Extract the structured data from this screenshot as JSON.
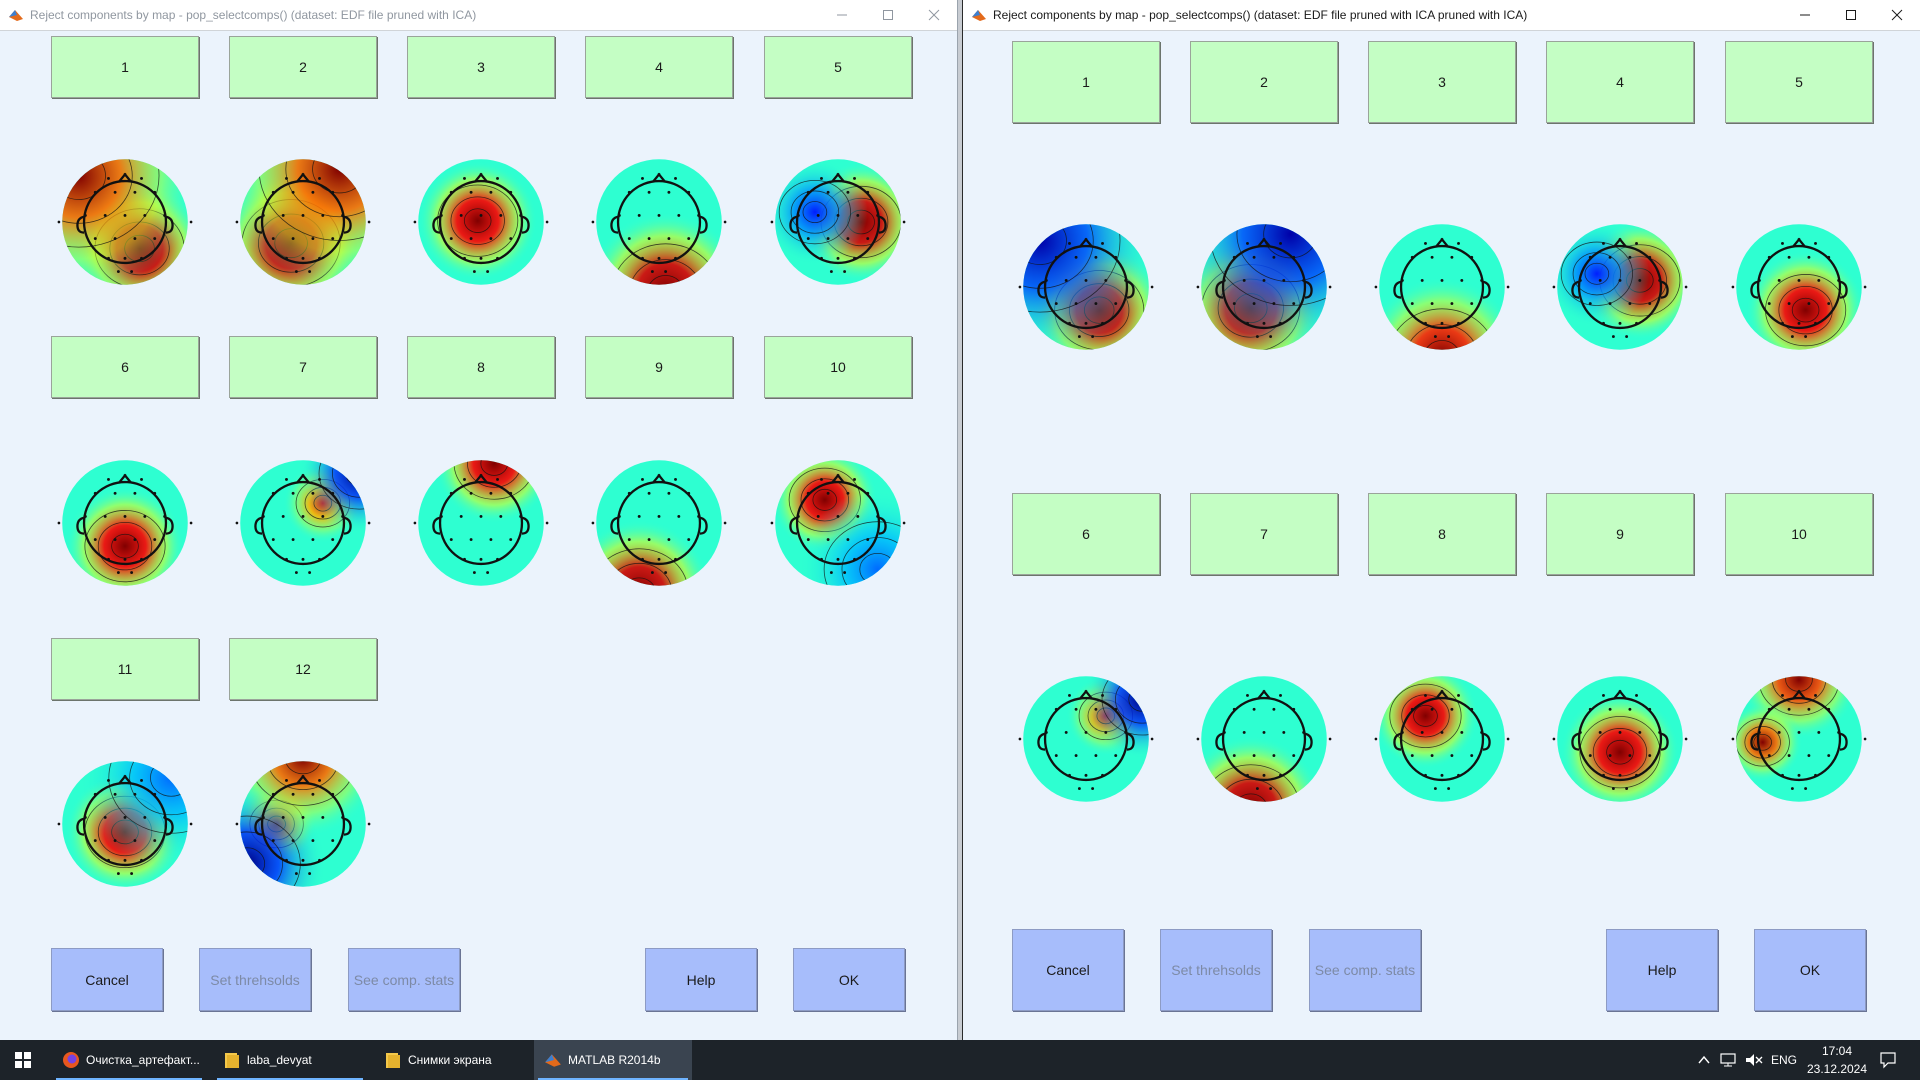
{
  "windows": [
    {
      "title": "Reject components by map - pop_selectcomps() (dataset: EDF file pruned with ICA)",
      "components": [
        "1",
        "2",
        "3",
        "4",
        "5",
        "6",
        "7",
        "8",
        "9",
        "10",
        "11",
        "12"
      ],
      "buttons": {
        "cancel": "Cancel",
        "set_thresholds": "Set threhsolds",
        "see_comp_stats": "See comp. stats",
        "help": "Help",
        "ok": "OK"
      }
    },
    {
      "title": "Reject components by map - pop_selectcomps() (dataset: EDF file pruned with ICA pruned with ICA)",
      "components": [
        "1",
        "2",
        "3",
        "4",
        "5",
        "6",
        "7",
        "8",
        "9",
        "10"
      ],
      "buttons": {
        "cancel": "Cancel",
        "set_thresholds": "Set threhsolds",
        "see_comp_stats": "See comp. stats",
        "help": "Help",
        "ok": "OK"
      }
    }
  ],
  "taskbar": {
    "items": [
      {
        "label": "Очистка_артефакт...",
        "icon": "firefox-icon"
      },
      {
        "label": "laba_devyat",
        "icon": "folder-icon"
      },
      {
        "label": "Снимки экрана",
        "icon": "folder-icon"
      },
      {
        "label": "MATLAB R2014b",
        "icon": "matlab-icon"
      }
    ],
    "language": "ENG",
    "time": "17:04",
    "date": "23.12.2024"
  },
  "colors": {
    "component_button": "#c4fec4",
    "action_button": "#a7bdfb",
    "window_background": "#ebf3fc",
    "taskbar": "#1d2329"
  }
}
